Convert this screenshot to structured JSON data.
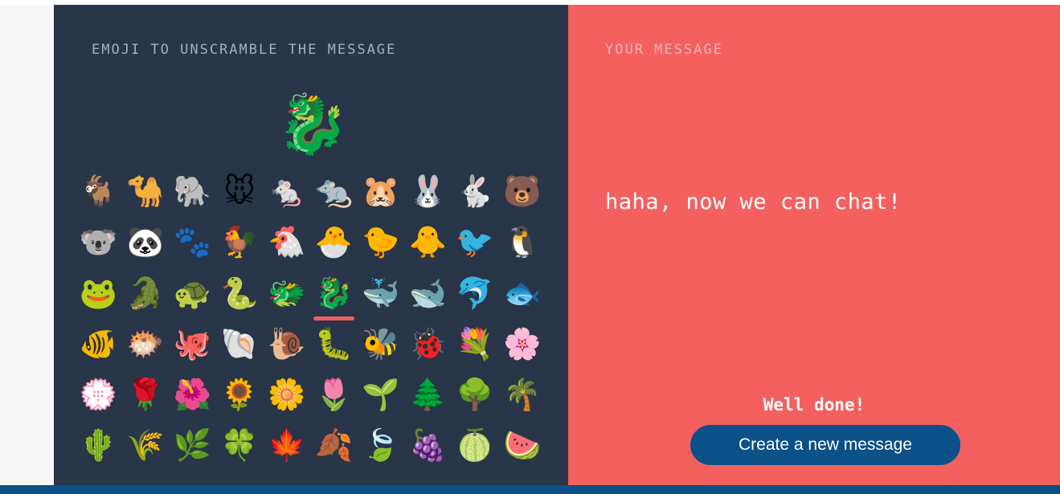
{
  "left_panel": {
    "heading": "EMOJI TO UNSCRAMBLE THE MESSAGE",
    "selected_emoji": "🐉",
    "selected_index": 25,
    "emoji_grid": [
      "🐐",
      "🐪",
      "🐘",
      "🐭",
      "🐁",
      "🐀",
      "🐹",
      "🐰",
      "🐇",
      "🐻",
      "🐨",
      "🐼",
      "🐾",
      "🐓",
      "🐔",
      "🐣",
      "🐤",
      "🐥",
      "🐦",
      "🐧",
      "🐸",
      "🐊",
      "🐢",
      "🐍",
      "🐲",
      "🐉",
      "🐳",
      "🐋",
      "🐬",
      "🐟",
      "🐠",
      "🐡",
      "🐙",
      "🐚",
      "🐌",
      "🐛",
      "🐝",
      "🐞",
      "💐",
      "🌸",
      "💮",
      "🌹",
      "🌺",
      "🌻",
      "🌼",
      "🌷",
      "🌱",
      "🌲",
      "🌳",
      "🌴",
      "🌵",
      "🌾",
      "🌿",
      "🍀",
      "🍁",
      "🍂",
      "🍃",
      "🍇",
      "🍈",
      "🍉"
    ]
  },
  "right_panel": {
    "heading": "YOUR MESSAGE",
    "message": "haha, now we can chat!",
    "done_text": "Well done!",
    "create_button_label": "Create a new message"
  },
  "colors": {
    "dark_panel": "#283447",
    "message_panel": "#f46060",
    "accent_bar": "#0b5087"
  }
}
